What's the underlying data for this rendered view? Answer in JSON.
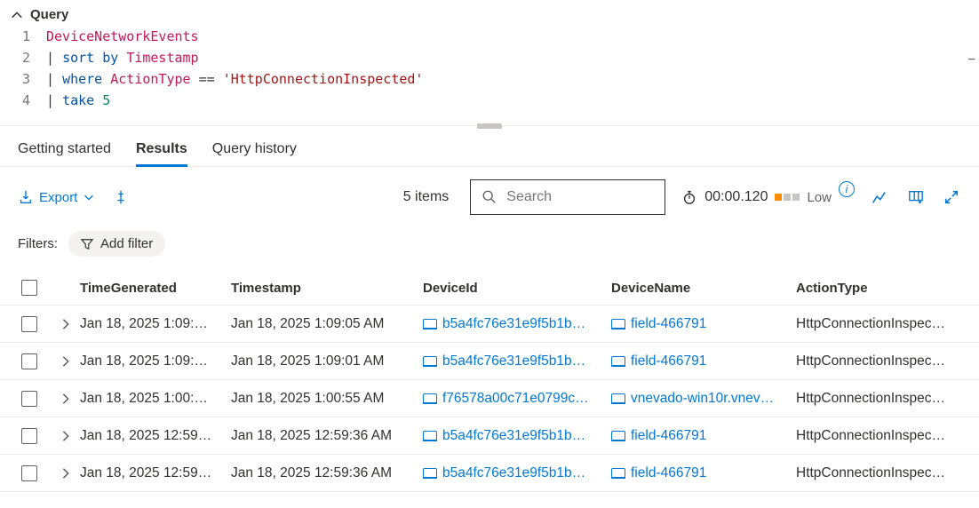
{
  "query_header": "Query",
  "editor": {
    "lines": [
      {
        "num": "1"
      },
      {
        "num": "2"
      },
      {
        "num": "3"
      },
      {
        "num": "4"
      }
    ],
    "tokens": {
      "l1_ident": "DeviceNetworkEvents",
      "pipe": "| ",
      "l2_kw1": "sort",
      "l2_kw2": "by",
      "l2_ident": "Timestamp",
      "l3_kw": "where",
      "l3_ident": "ActionType",
      "l3_op": " == ",
      "l3_str": "'HttpConnectionInspected'",
      "l4_kw": "take",
      "l4_num": "5"
    },
    "minus": "−"
  },
  "tabs": {
    "getting_started": "Getting started",
    "results": "Results",
    "query_history": "Query history"
  },
  "toolbar": {
    "export": "Export",
    "items_count": "5 items",
    "search_placeholder": "Search",
    "elapsed": "00:00.120",
    "low_label": "Low"
  },
  "filters": {
    "label": "Filters:",
    "add_filter": "Add filter"
  },
  "columns": {
    "time_generated": "TimeGenerated",
    "timestamp": "Timestamp",
    "device_id": "DeviceId",
    "device_name": "DeviceName",
    "action_type": "ActionType"
  },
  "rows": [
    {
      "time_generated": "Jan 18, 2025 1:09:…",
      "timestamp": "Jan 18, 2025 1:09:05 AM",
      "device_id": "b5a4fc76e31e9f5b1b…",
      "device_name": "field-466791",
      "action_type": "HttpConnectionInspected"
    },
    {
      "time_generated": "Jan 18, 2025 1:09:…",
      "timestamp": "Jan 18, 2025 1:09:01 AM",
      "device_id": "b5a4fc76e31e9f5b1b…",
      "device_name": "field-466791",
      "action_type": "HttpConnectionInspected"
    },
    {
      "time_generated": "Jan 18, 2025 1:00:…",
      "timestamp": "Jan 18, 2025 1:00:55 AM",
      "device_id": "f76578a00c71e0799c…",
      "device_name": "vnevado-win10r.vnev…",
      "action_type": "HttpConnectionInspected"
    },
    {
      "time_generated": "Jan 18, 2025 12:59…",
      "timestamp": "Jan 18, 2025 12:59:36 AM",
      "device_id": "b5a4fc76e31e9f5b1b…",
      "device_name": "field-466791",
      "action_type": "HttpConnectionInspected"
    },
    {
      "time_generated": "Jan 18, 2025 12:59…",
      "timestamp": "Jan 18, 2025 12:59:36 AM",
      "device_id": "b5a4fc76e31e9f5b1b…",
      "device_name": "field-466791",
      "action_type": "HttpConnectionInspected"
    }
  ]
}
